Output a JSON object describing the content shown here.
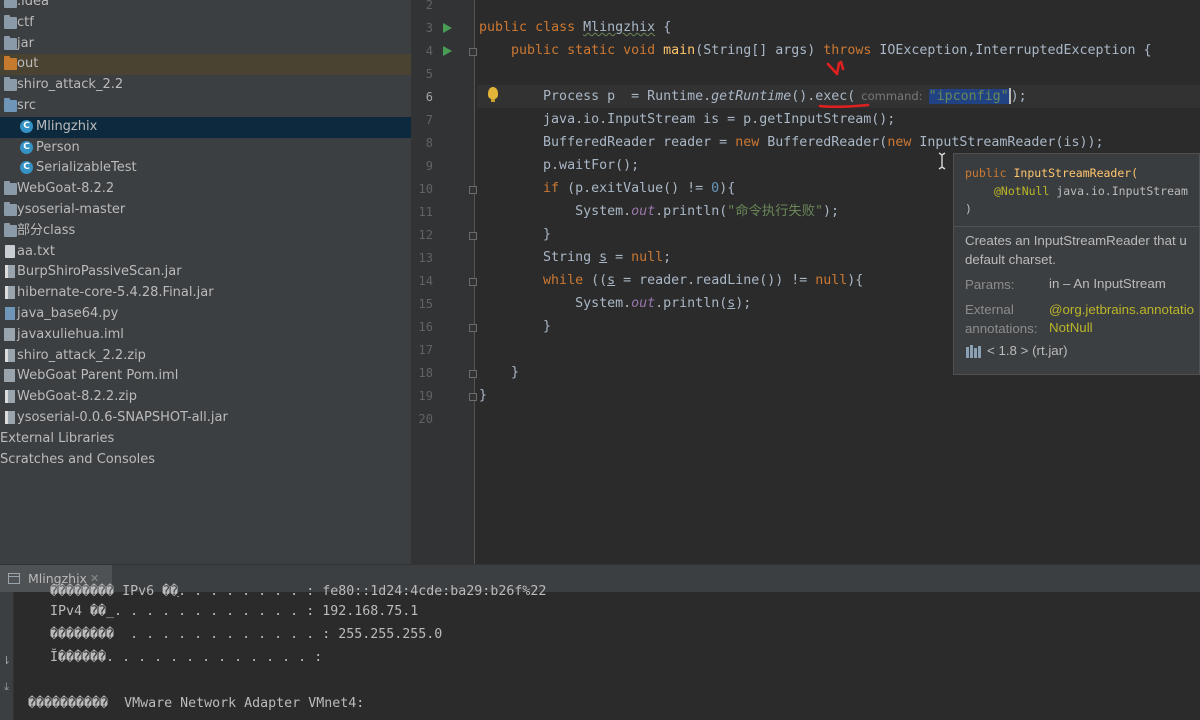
{
  "project_tree": {
    "items": [
      {
        "label": ".idea",
        "icon": "folder-icon"
      },
      {
        "label": "ctf",
        "icon": "folder-icon"
      },
      {
        "label": "jar",
        "icon": "folder-icon"
      },
      {
        "label": "out",
        "icon": "folder-icon"
      },
      {
        "label": "shiro_attack_2.2",
        "icon": "folder-icon"
      },
      {
        "label": "src",
        "icon": "folder-icon"
      },
      {
        "label": "Mlingzhix",
        "icon": "java-class-icon"
      },
      {
        "label": "Person",
        "icon": "java-class-icon"
      },
      {
        "label": "SerializableTest",
        "icon": "java-class-icon"
      },
      {
        "label": "WebGoat-8.2.2",
        "icon": "folder-icon"
      },
      {
        "label": "ysoserial-master",
        "icon": "folder-icon"
      },
      {
        "label": "部分class",
        "icon": "folder-icon"
      },
      {
        "label": "aa.txt",
        "icon": "text-file-icon"
      },
      {
        "label": "BurpShiroPassiveScan.jar",
        "icon": "jar-file-icon"
      },
      {
        "label": "hibernate-core-5.4.28.Final.jar",
        "icon": "jar-file-icon"
      },
      {
        "label": "java_base64.py",
        "icon": "python-file-icon"
      },
      {
        "label": "javaxuliehua.iml",
        "icon": "module-file-icon"
      },
      {
        "label": "shiro_attack_2.2.zip",
        "icon": "archive-file-icon"
      },
      {
        "label": "WebGoat Parent Pom.iml",
        "icon": "module-file-icon"
      },
      {
        "label": "WebGoat-8.2.2.zip",
        "icon": "archive-file-icon"
      },
      {
        "label": "ysoserial-0.0.6-SNAPSHOT-all.jar",
        "icon": "jar-file-icon"
      },
      {
        "label": "External Libraries",
        "icon": "library-icon"
      },
      {
        "label": "Scratches and Consoles",
        "icon": "scratches-icon"
      }
    ]
  },
  "editor": {
    "line_numbers": [
      "2",
      "3",
      "4",
      "5",
      "6",
      "7",
      "8",
      "9",
      "10",
      "11",
      "12",
      "13",
      "14",
      "15",
      "16",
      "17",
      "18",
      "19",
      "20"
    ],
    "code": {
      "l3": {
        "kw_public": "public",
        "kw_class": "class",
        "class_name": "Mlingzhix",
        "brace": "{"
      },
      "l4": {
        "mods": "public static void",
        "method": "main",
        "params": "(String[] args)",
        "kw_throws": "throws",
        "exceptions": "IOException,InterruptedException {"
      },
      "l6": {
        "decl": "Process p  = Runtime.",
        "get_runtime": "getRuntime",
        "paren": "()",
        "exec": ".exec(",
        "hint": "command:",
        "arg": "\"ipconfig\"",
        "end": ");"
      },
      "l7": "java.io.InputStream is = p.getInputStream();",
      "l8": {
        "decl": "BufferedReader reader = ",
        "kw_new1": "new",
        "ctor": " BufferedReader(",
        "kw_new2": "new",
        "inner": " InputStreamReader(is));"
      },
      "l9": "p.waitFor();",
      "l10": {
        "kw_if": "if",
        "cond": " (p.exitValue() != ",
        "num": "0",
        "end": "){"
      },
      "l11": {
        "prefix": "System.",
        "out": "out",
        "call": ".println(",
        "str": "\"命令执行失败\"",
        "end": ");"
      },
      "l12": "}",
      "l13": {
        "decl": "String ",
        "var": "s",
        "eq": " = ",
        "kw_null": "null",
        "end": ";"
      },
      "l14": {
        "kw_while": "while",
        "open": " ((",
        "var": "s",
        "mid": " = reader.readLine()) != ",
        "kw_null": "null",
        "end": "){"
      },
      "l15": {
        "prefix": "System.",
        "out": "out",
        "call": ".println(",
        "var": "s",
        "end": ");"
      },
      "l16": "}",
      "l18": "}",
      "l19": "}"
    }
  },
  "doc_popup": {
    "sig_public": "public",
    "sig_name": "InputStreamReader(",
    "sig_annotation": "@NotNull",
    "sig_param": "java.io.InputStream",
    "sig_close": ")",
    "description_line1": "Creates an InputStreamReader that u",
    "description_line2": "default charset.",
    "params_key": "Params:",
    "params_value": "in – An InputStream",
    "external_key_1": "External",
    "external_key_2": "annotations:",
    "external_value_1": "@org.jetbrains.annotatio",
    "external_value_2": "NotNull",
    "library": "< 1.8 > (rt.jar)"
  },
  "run_panel": {
    "tab_label": "Mlingzhix",
    "tab_close": "✕",
    "console_lines": [
      "   �������� IPv6 ��ַ. . . . . . . . : fe80::1d24:4cde:ba29:b26f%22",
      "   IPv4 ��_. . . . . . . . . . . . : 192.168.75.1",
      "   ��������  . . . . . . . . . . . . : 255.255.255.0",
      "   Ĭ������. . . . . . . . . . . . . :",
      "",
      "����������  VMware Network Adapter VMnet4:"
    ]
  },
  "colors": {
    "keyword": "#cc7832",
    "method": "#ffc66d",
    "string": "#6a8759",
    "number": "#6897bb",
    "field": "#9876aa",
    "selection": "#0d293e",
    "annotation_red": "#e02020"
  }
}
